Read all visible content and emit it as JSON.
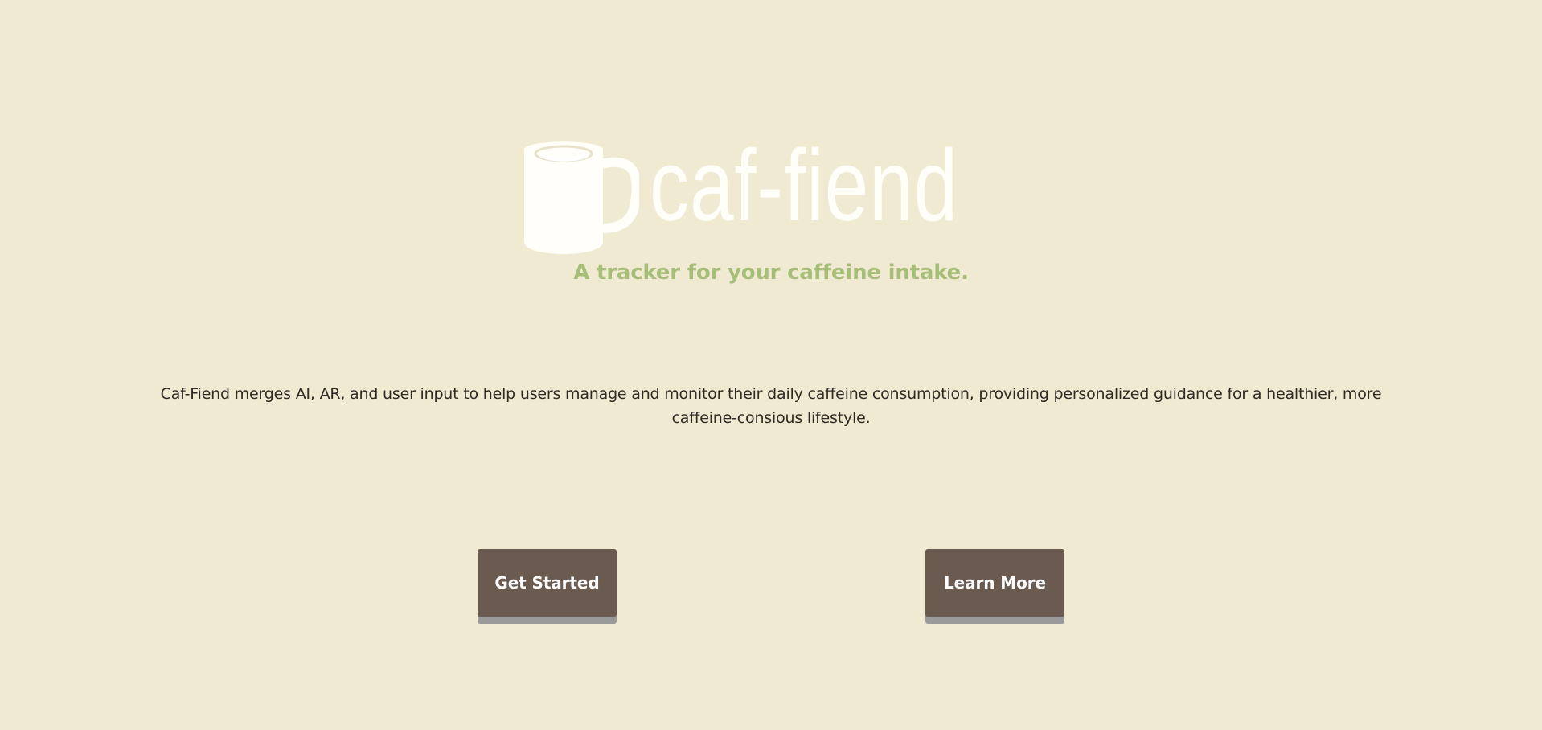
{
  "brand": {
    "name": "caf-fiend",
    "tagline": "A tracker for your caffeine intake.",
    "logo_icon": "coffee-mug-icon"
  },
  "main": {
    "description": "Caf-Fiend merges AI, AR, and user input to help users manage and monitor their daily caffeine consumption, providing personalized guidance for a healthier, more caffeine-consious lifestyle."
  },
  "actions": {
    "primary": "Get Started",
    "secondary": "Learn More"
  },
  "colors": {
    "background": "#f0ead3",
    "logo": "#fffef9",
    "tagline": "#a6be78",
    "button": "#6b5a4f",
    "button_shadow": "#9a9a9a",
    "text": "#2f2a24"
  }
}
